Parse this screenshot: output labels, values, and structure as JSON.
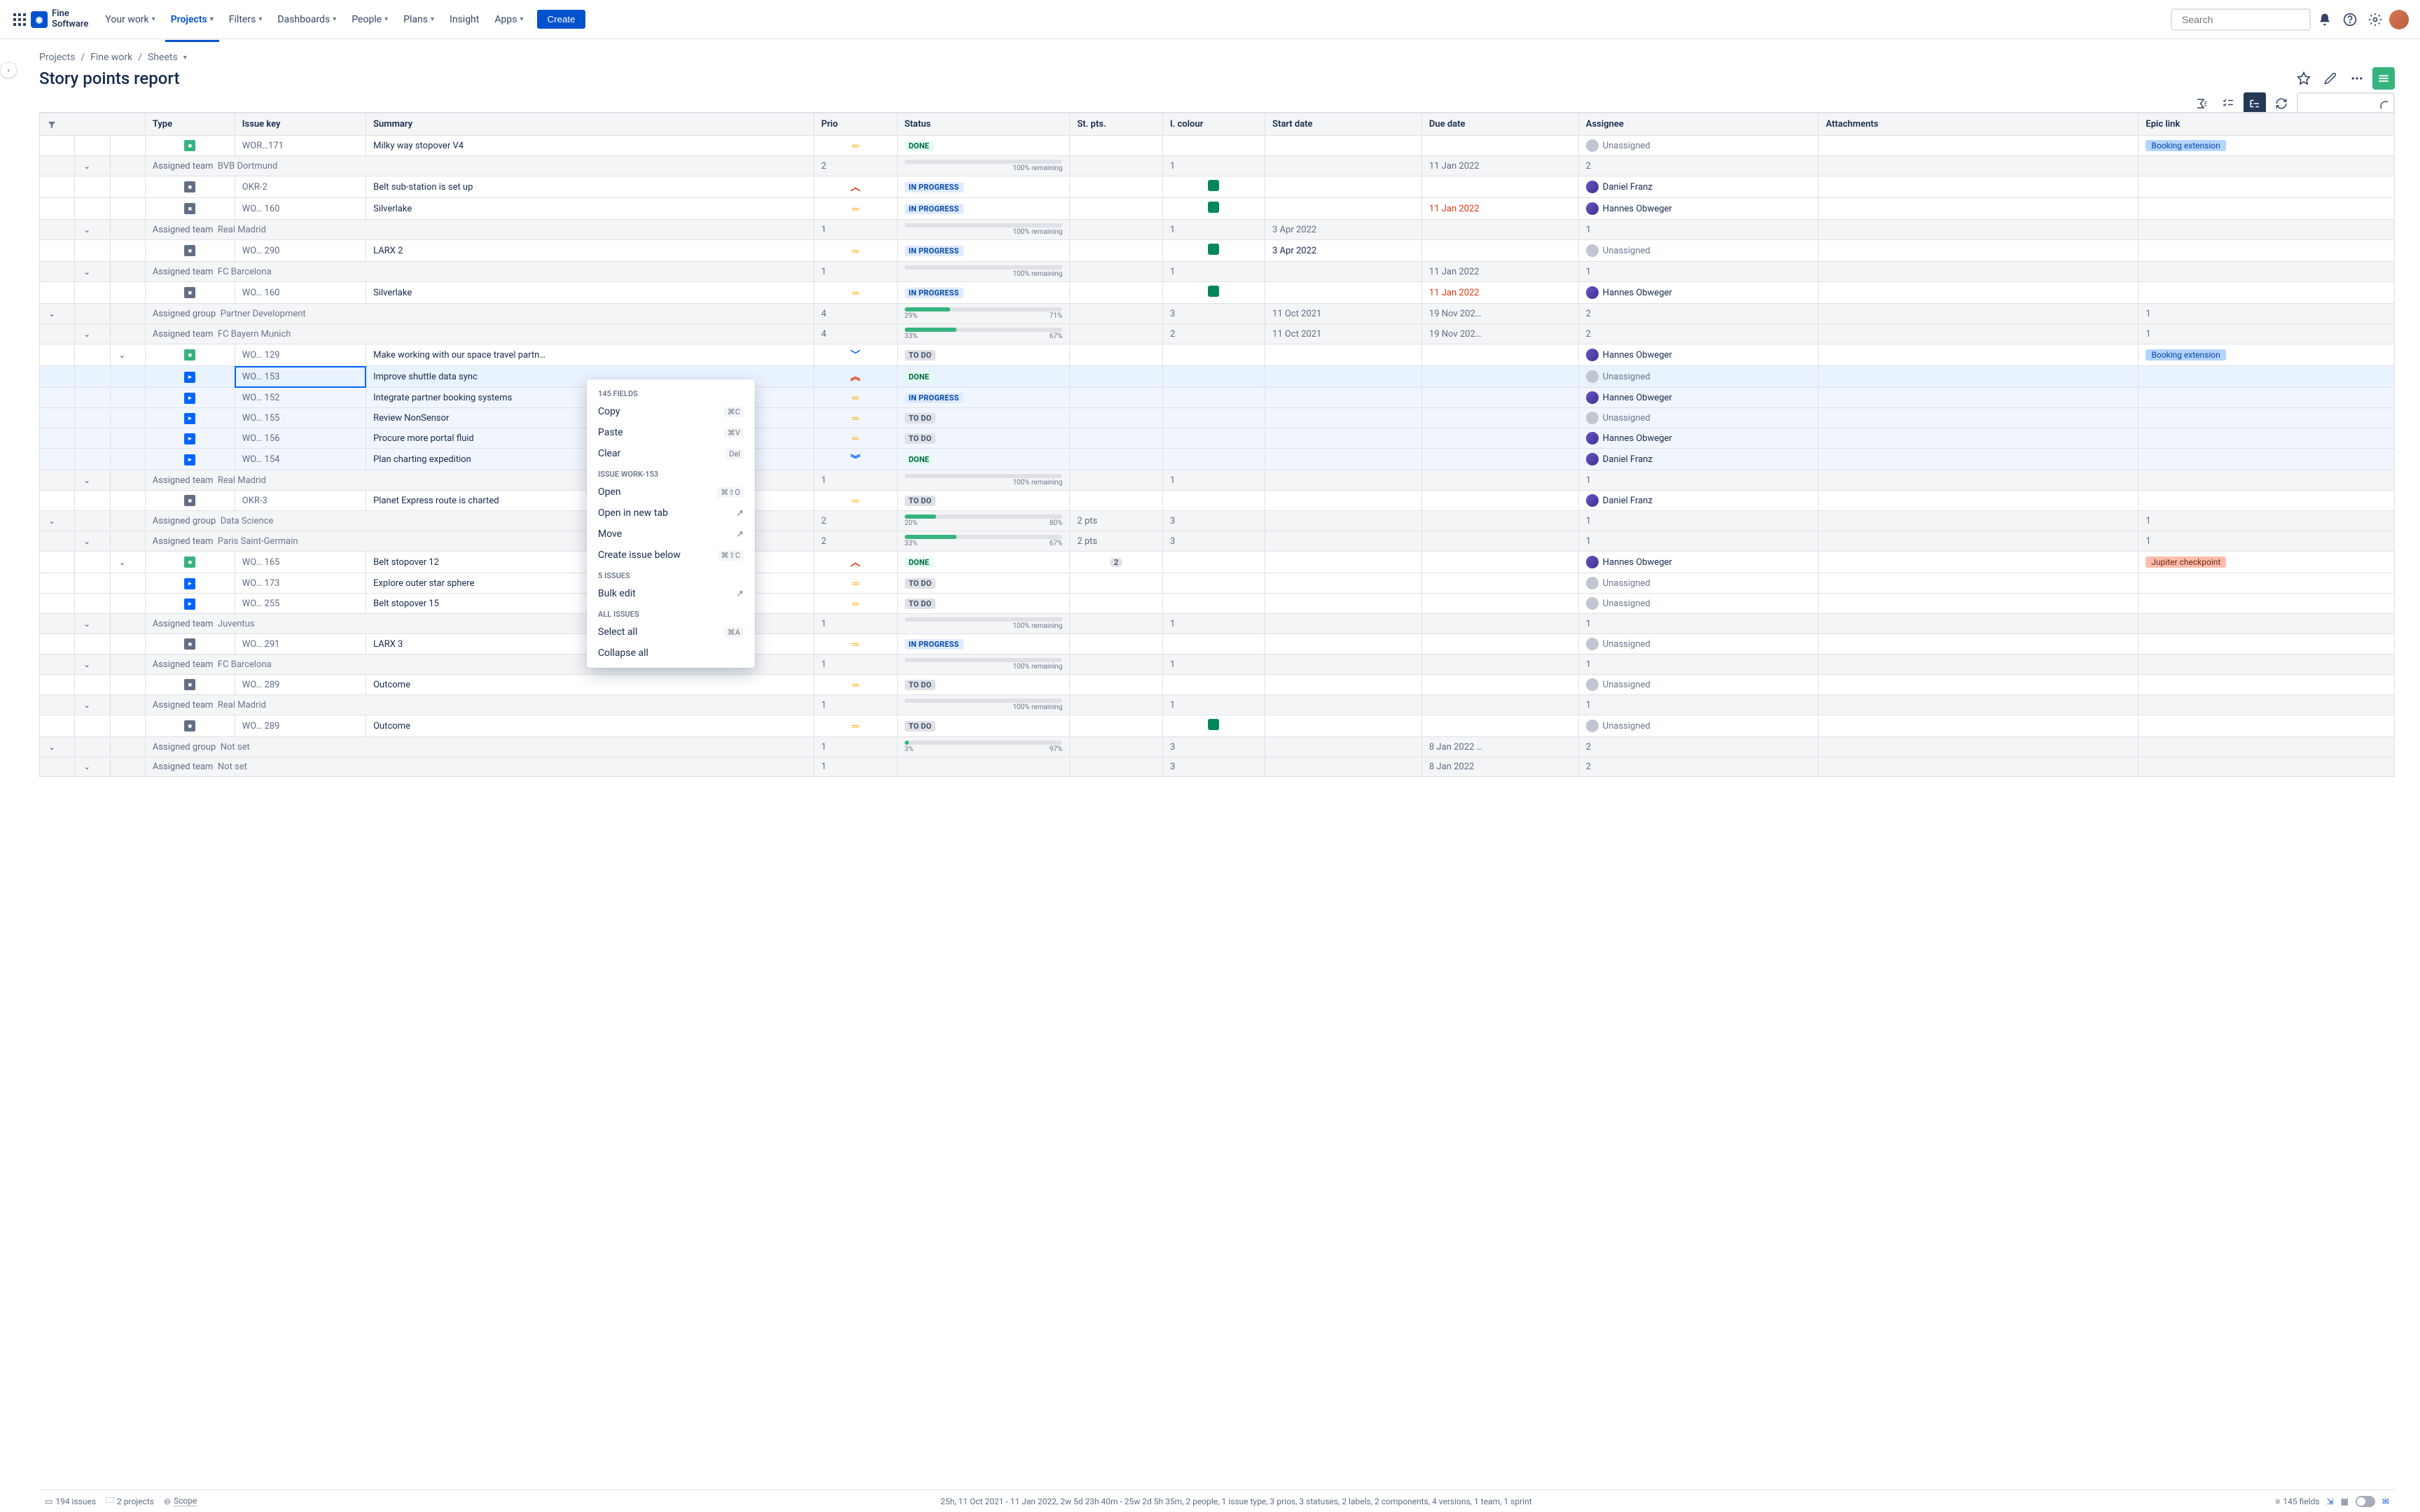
{
  "nav": {
    "logo": "Fine\nSoftware",
    "items": [
      "Your work",
      "Projects",
      "Filters",
      "Dashboards",
      "People",
      "Plans",
      "Insight",
      "Apps"
    ],
    "active": 1,
    "create": "Create",
    "searchPlaceholder": "Search"
  },
  "breadcrumbs": [
    "Projects",
    "Fine work",
    "Sheets"
  ],
  "title": "Story points report",
  "columns": [
    "Type",
    "Issue key",
    "Summary",
    "Prio",
    "Status",
    "St. pts.",
    "I. colour",
    "Start date",
    "Due date",
    "Assignee",
    "Attachments",
    "Epic link"
  ],
  "rows": [
    {
      "kind": "issue",
      "type": "story",
      "key": "WOR…171",
      "summary": "Milky way stopover V4",
      "prio": "med",
      "status": "DONE",
      "assignee": "Unassigned",
      "epic": "Booking extension",
      "epicColor": "blue"
    },
    {
      "kind": "group",
      "level": 1,
      "label": "Assigned team",
      "value": "BVB Dortmund",
      "count": "2",
      "progress": {
        "pct": 100,
        "label": "100% remaining"
      },
      "pts": "1",
      "due": "11 Jan 2022",
      "agg": "2"
    },
    {
      "kind": "issue",
      "type": "task",
      "key": "OKR-2",
      "summary": "Belt sub-station is set up",
      "prio": "high",
      "status": "IN PROGRESS",
      "colour": true,
      "assignee": "Daniel Franz"
    },
    {
      "kind": "issue",
      "type": "task",
      "key": "WO… 160",
      "summary": "Silverlake",
      "prio": "med",
      "status": "IN PROGRESS",
      "colour": true,
      "due": "11 Jan 2022",
      "dueOver": true,
      "assignee": "Hannes Obweger"
    },
    {
      "kind": "group",
      "level": 1,
      "label": "Assigned team",
      "value": "Real Madrid",
      "count": "1",
      "progress": {
        "pct": 100,
        "label": "100% remaining"
      },
      "pts": "1",
      "start": "3 Apr 2022",
      "agg": "1"
    },
    {
      "kind": "issue",
      "type": "task",
      "key": "WO… 290",
      "summary": "LARX 2",
      "prio": "med",
      "status": "IN PROGRESS",
      "colour": true,
      "start": "3 Apr 2022",
      "assignee": "Unassigned"
    },
    {
      "kind": "group",
      "level": 1,
      "label": "Assigned team",
      "value": "FC Barcelona",
      "count": "1",
      "progress": {
        "pct": 100,
        "label": "100% remaining"
      },
      "pts": "1",
      "due": "11 Jan 2022",
      "agg": "1"
    },
    {
      "kind": "issue",
      "type": "task",
      "key": "WO… 160",
      "summary": "Silverlake",
      "prio": "med",
      "status": "IN PROGRESS",
      "colour": true,
      "due": "11 Jan 2022",
      "dueOver": true,
      "assignee": "Hannes Obweger"
    },
    {
      "kind": "group",
      "level": 0,
      "label": "Assigned group",
      "value": "Partner Development",
      "count": "4",
      "progress": {
        "left": "29%",
        "right": "71%",
        "pct": 29
      },
      "pts": "3",
      "start": "11 Oct 2021",
      "due": "19 Nov 202…",
      "agg": "2",
      "epicAgg": "1"
    },
    {
      "kind": "group",
      "level": 1,
      "label": "Assigned team",
      "value": "FC Bayern Munich",
      "count": "4",
      "progress": {
        "left": "33%",
        "right": "67%",
        "pct": 33
      },
      "pts": "2",
      "start": "11 Oct 2021",
      "due": "19 Nov 202…",
      "agg": "2",
      "epicAgg": "1"
    },
    {
      "kind": "issue",
      "level": 2,
      "type": "story",
      "key": "WO… 129",
      "summary": "Make working with our space travel partn…",
      "prio": "low",
      "status": "TO DO",
      "assignee": "Hannes Obweger",
      "epic": "Booking extension",
      "epicColor": "blue"
    },
    {
      "kind": "issue",
      "level": 3,
      "child": true,
      "selected": true,
      "type": "sub",
      "key": "WO… 153",
      "summary": "Improve shuttle data sync",
      "prio": "highest",
      "status": "DONE",
      "assignee": "Unassigned"
    },
    {
      "kind": "issue",
      "level": 3,
      "child": true,
      "type": "sub",
      "key": "WO… 152",
      "summary": "Integrate partner booking systems",
      "prio": "med",
      "status": "IN PROGRESS",
      "assignee": "Hannes Obweger"
    },
    {
      "kind": "issue",
      "level": 3,
      "child": true,
      "type": "sub",
      "key": "WO… 155",
      "summary": "Review NonSensor",
      "prio": "med",
      "status": "TO DO",
      "assignee": "Unassigned"
    },
    {
      "kind": "issue",
      "level": 3,
      "child": true,
      "type": "sub",
      "key": "WO… 156",
      "summary": "Procure more portal fluid",
      "prio": "med",
      "status": "TO DO",
      "assignee": "Hannes Obweger"
    },
    {
      "kind": "issue",
      "level": 3,
      "child": true,
      "type": "sub",
      "key": "WO… 154",
      "summary": "Plan charting expedition",
      "prio": "lowest",
      "status": "DONE",
      "assignee": "Daniel Franz"
    },
    {
      "kind": "group",
      "level": 1,
      "label": "Assigned team",
      "value": "Real Madrid",
      "count": "1",
      "progress": {
        "pct": 100,
        "label": "100% remaining"
      },
      "pts": "1",
      "agg": "1"
    },
    {
      "kind": "issue",
      "type": "task",
      "key": "OKR-3",
      "summary": "Planet Express route is charted",
      "prio": "med",
      "status": "TO DO",
      "assignee": "Daniel Franz"
    },
    {
      "kind": "group",
      "level": 0,
      "label": "Assigned group",
      "value": "Data Science",
      "count": "2",
      "progress": {
        "left": "20%",
        "right": "80%",
        "pct": 20
      },
      "ptsTxt": "2 pts",
      "pts": "3",
      "agg": "1",
      "epicAgg": "1"
    },
    {
      "kind": "group",
      "level": 1,
      "label": "Assigned team",
      "value": "Paris Saint-Germain",
      "count": "2",
      "progress": {
        "left": "33%",
        "right": "67%",
        "pct": 33
      },
      "ptsTxt": "2 pts",
      "pts": "3",
      "agg": "1",
      "epicAgg": "1"
    },
    {
      "kind": "issue",
      "level": 2,
      "type": "story",
      "key": "WO… 165",
      "summary": "Belt stopover 12",
      "prio": "high",
      "status": "DONE",
      "ptsPill": "2",
      "assignee": "Hannes Obweger",
      "epic": "Jupiter checkpoint",
      "epicColor": "orange"
    },
    {
      "kind": "issue",
      "level": 3,
      "type": "sub",
      "key": "WO… 173",
      "summary": "Explore outer star sphere",
      "prio": "med",
      "status": "TO DO",
      "assignee": "Unassigned"
    },
    {
      "kind": "issue",
      "level": 3,
      "type": "sub",
      "key": "WO… 255",
      "summary": "Belt stopover 15",
      "prio": "med",
      "status": "TO DO",
      "assignee": "Unassigned"
    },
    {
      "kind": "group",
      "level": 1,
      "label": "Assigned team",
      "value": "Juventus",
      "count": "1",
      "progress": {
        "pct": 100,
        "label": "100% remaining"
      },
      "pts": "1",
      "agg": "1"
    },
    {
      "kind": "issue",
      "type": "task",
      "key": "WO… 291",
      "summary": "LARX 3",
      "prio": "med",
      "status": "IN PROGRESS",
      "assignee": "Unassigned"
    },
    {
      "kind": "group",
      "level": 1,
      "label": "Assigned team",
      "value": "FC Barcelona",
      "count": "1",
      "progress": {
        "pct": 100,
        "label": "100% remaining"
      },
      "pts": "1",
      "agg": "1"
    },
    {
      "kind": "issue",
      "type": "task",
      "key": "WO… 289",
      "summary": "Outcome",
      "prio": "med",
      "status": "TO DO",
      "assignee": "Unassigned"
    },
    {
      "kind": "group",
      "level": 1,
      "label": "Assigned team",
      "value": "Real Madrid",
      "count": "1",
      "progress": {
        "pct": 100,
        "label": "100% remaining"
      },
      "pts": "1",
      "agg": "1"
    },
    {
      "kind": "issue",
      "type": "task",
      "key": "WO… 289",
      "summary": "Outcome",
      "prio": "med",
      "status": "TO DO",
      "colour": true,
      "assignee": "Unassigned"
    },
    {
      "kind": "group",
      "level": 0,
      "label": "Assigned group",
      "value": "Not set",
      "count": "1",
      "progress": {
        "left": "3%",
        "right": "97%",
        "pct": 3
      },
      "pts": "3",
      "due": "8 Jan 2022 …",
      "agg": "2"
    },
    {
      "kind": "group",
      "level": 1,
      "label": "Assigned team",
      "value": "Not set",
      "count": "1",
      "pts": "3",
      "due": "8 Jan 2022",
      "agg": "2"
    }
  ],
  "contextMenu": {
    "fieldsHeader": "145 FIELDS",
    "copy": "Copy",
    "copyK": "⌘C",
    "paste": "Paste",
    "pasteK": "⌘V",
    "clear": "Clear",
    "clearK": "Del",
    "issueHeader": "ISSUE WORK-153",
    "open": "Open",
    "openK": "⌘⇧O",
    "openNew": "Open in new tab",
    "move": "Move",
    "createBelow": "Create issue below",
    "createK": "⌘⇧C",
    "multiHeader": "5 ISSUES",
    "bulk": "Bulk edit",
    "allHeader": "ALL ISSUES",
    "selectAll": "Select all",
    "selectAllK": "⌘A",
    "collapse": "Collapse all"
  },
  "footer": {
    "issues": "194 issues",
    "projects": "2 projects",
    "scope": "Scope",
    "center": "25h, 11 Oct 2021 - 11 Jan 2022, 2w 5d 23h 40m - 25w 2d 5h 35m, 2 people, 1 issue type, 3 prios, 3 statuses, 2 labels, 2 components, 4 versions, 1 team, 1 sprint",
    "fields": "145 fields"
  }
}
